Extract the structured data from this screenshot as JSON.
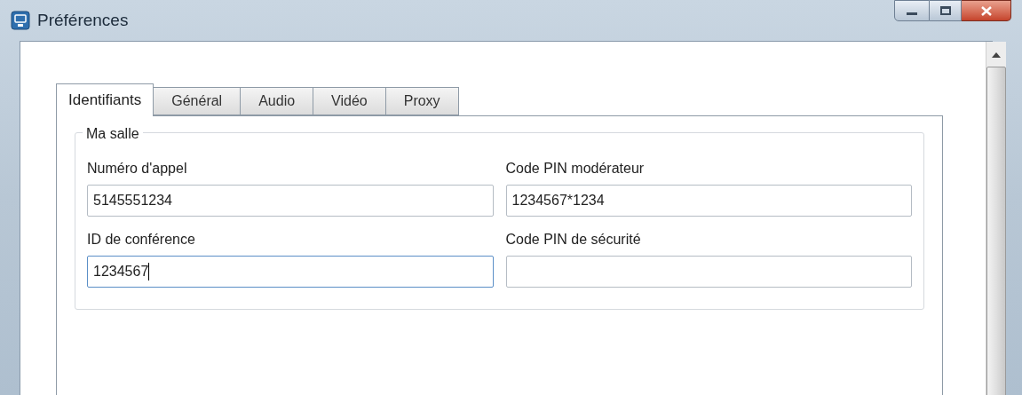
{
  "window": {
    "title": "Préférences"
  },
  "tabs": [
    {
      "label": "Identifiants",
      "selected": true
    },
    {
      "label": "Général",
      "selected": false
    },
    {
      "label": "Audio",
      "selected": false
    },
    {
      "label": "Vidéo",
      "selected": false
    },
    {
      "label": "Proxy",
      "selected": false
    }
  ],
  "group": {
    "title": "Ma salle",
    "fields": [
      {
        "label": "Numéro d'appel",
        "value": "5145551234",
        "focused": false
      },
      {
        "label": "Code PIN modérateur",
        "value": "1234567*1234",
        "focused": false
      },
      {
        "label": "ID de conférence",
        "value": "1234567",
        "focused": true
      },
      {
        "label": "Code PIN de sécurité",
        "focused": false
      }
    ]
  }
}
